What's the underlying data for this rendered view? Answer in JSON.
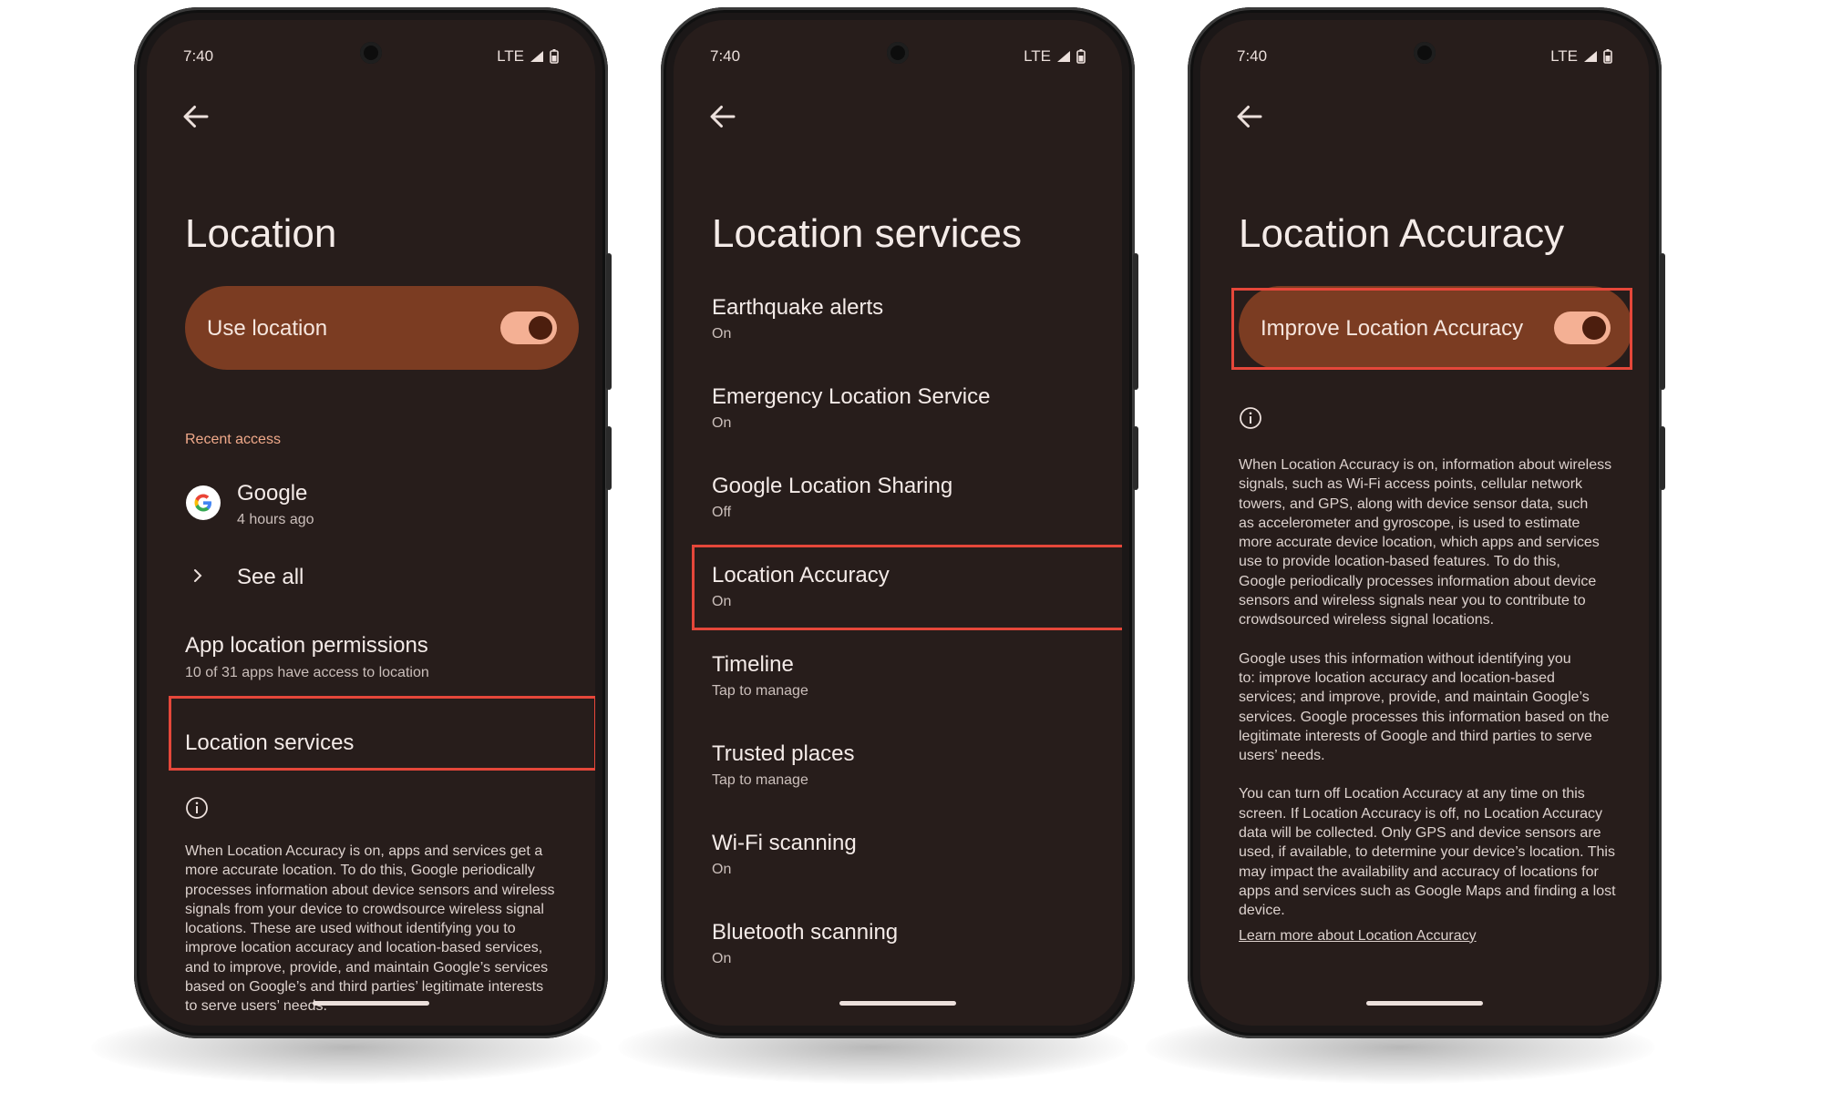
{
  "status": {
    "time": "7:40",
    "network": "LTE"
  },
  "screens": {
    "location": {
      "title": "Location",
      "use_location_label": "Use location",
      "recent_access_label": "Recent access",
      "recent_app_name": "Google",
      "recent_app_time": "4 hours ago",
      "see_all_label": "See all",
      "permissions_title": "App location permissions",
      "permissions_sub": "10 of 31 apps have access to location",
      "services_label": "Location services",
      "footer_lines": [
        "When Location Accuracy is on, apps and services get a",
        "more accurate location. To do this, Google periodically",
        "processes information about device sensors and wireless",
        "signals from your device to crowdsource wireless signal",
        "locations. These are used without identifying you to",
        "improve location accuracy and location-based services,",
        "and to improve, provide, and maintain Google’s services",
        "based on Google’s and third parties’ legitimate interests",
        "to serve users’ needs."
      ]
    },
    "services": {
      "title": "Location services",
      "items": [
        {
          "title": "Earthquake alerts",
          "sub": "On"
        },
        {
          "title": "Emergency Location Service",
          "sub": "On"
        },
        {
          "title": "Google Location Sharing",
          "sub": "Off"
        },
        {
          "title": "Location Accuracy",
          "sub": "On"
        },
        {
          "title": "Timeline",
          "sub": "Tap to manage"
        },
        {
          "title": "Trusted places",
          "sub": "Tap to manage"
        },
        {
          "title": "Wi-Fi scanning",
          "sub": "On"
        },
        {
          "title": "Bluetooth scanning",
          "sub": "On"
        }
      ]
    },
    "accuracy": {
      "title": "Location Accuracy",
      "toggle_label": "Improve Location Accuracy",
      "para1": [
        "When Location Accuracy is on, information about wireless",
        "signals, such as Wi-Fi access points, cellular network",
        "towers, and GPS, along with device sensor data, such",
        "as accelerometer and gyroscope, is used to estimate",
        "more accurate device location, which apps and services",
        "use to provide location-based features. To do this,",
        "Google periodically processes information about device",
        "sensors and wireless signals near you to contribute to",
        "crowdsourced wireless signal locations."
      ],
      "para2": [
        "Google uses this information without identifying you",
        "to: improve location accuracy and location-based",
        "services; and improve, provide, and maintain Google’s",
        "services. Google processes this information based on the",
        "legitimate interests of Google and third parties to serve",
        "users’ needs."
      ],
      "para3": [
        "You can turn off Location Accuracy at any time on this",
        "screen. If Location Accuracy is off, no Location Accuracy",
        "data will be collected. Only GPS and device sensors are",
        "used, if available, to determine your device’s location. This",
        "may impact the availability and accuracy of locations for",
        "apps and services such as Google Maps and finding a lost",
        "device."
      ],
      "learn_more": "Learn more about Location Accuracy"
    }
  },
  "colors": {
    "screen_bg": "#271d1b",
    "toggle_card": "#7b3c22",
    "switch_track": "#f4b094",
    "accent_text": "#f0a98a",
    "highlight": "#e5473a"
  },
  "icons": [
    "back-arrow-icon",
    "signal-icon",
    "battery-icon",
    "google-logo",
    "chevron-right-icon",
    "info-icon"
  ]
}
